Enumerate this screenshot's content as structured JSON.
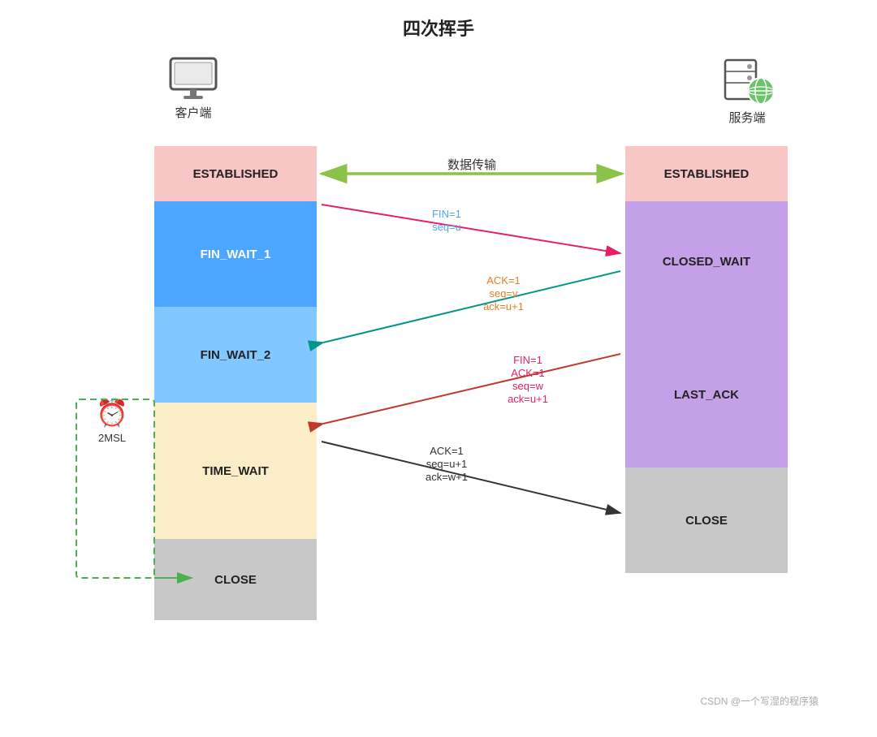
{
  "title": "四次挥手",
  "client_label": "客户端",
  "server_label": "服务端",
  "states": {
    "established_left": "ESTABLISHED",
    "fin_wait_1": "FIN_WAIT_1",
    "fin_wait_2": "FIN_WAIT_2",
    "time_wait": "TIME_WAIT",
    "close_left": "CLOSE",
    "established_right": "ESTABLISHED",
    "closed_wait": "CLOSED_WAIT",
    "last_ack": "LAST_ACK",
    "close_right": "CLOSE"
  },
  "messages": {
    "fin1": "FIN=1\nseq=u",
    "ack1": "ACK=1\nseq=v\nack=u+1",
    "fin2": "FIN=1\nACK=1\nseq=w\nack=u+1",
    "ack2": "ACK=1\nseq=u+1\nack=w+1"
  },
  "data_transfer": "数据传输",
  "timer_label": "2MSL",
  "watermark": "CSDN @一个写湿的程序猿"
}
